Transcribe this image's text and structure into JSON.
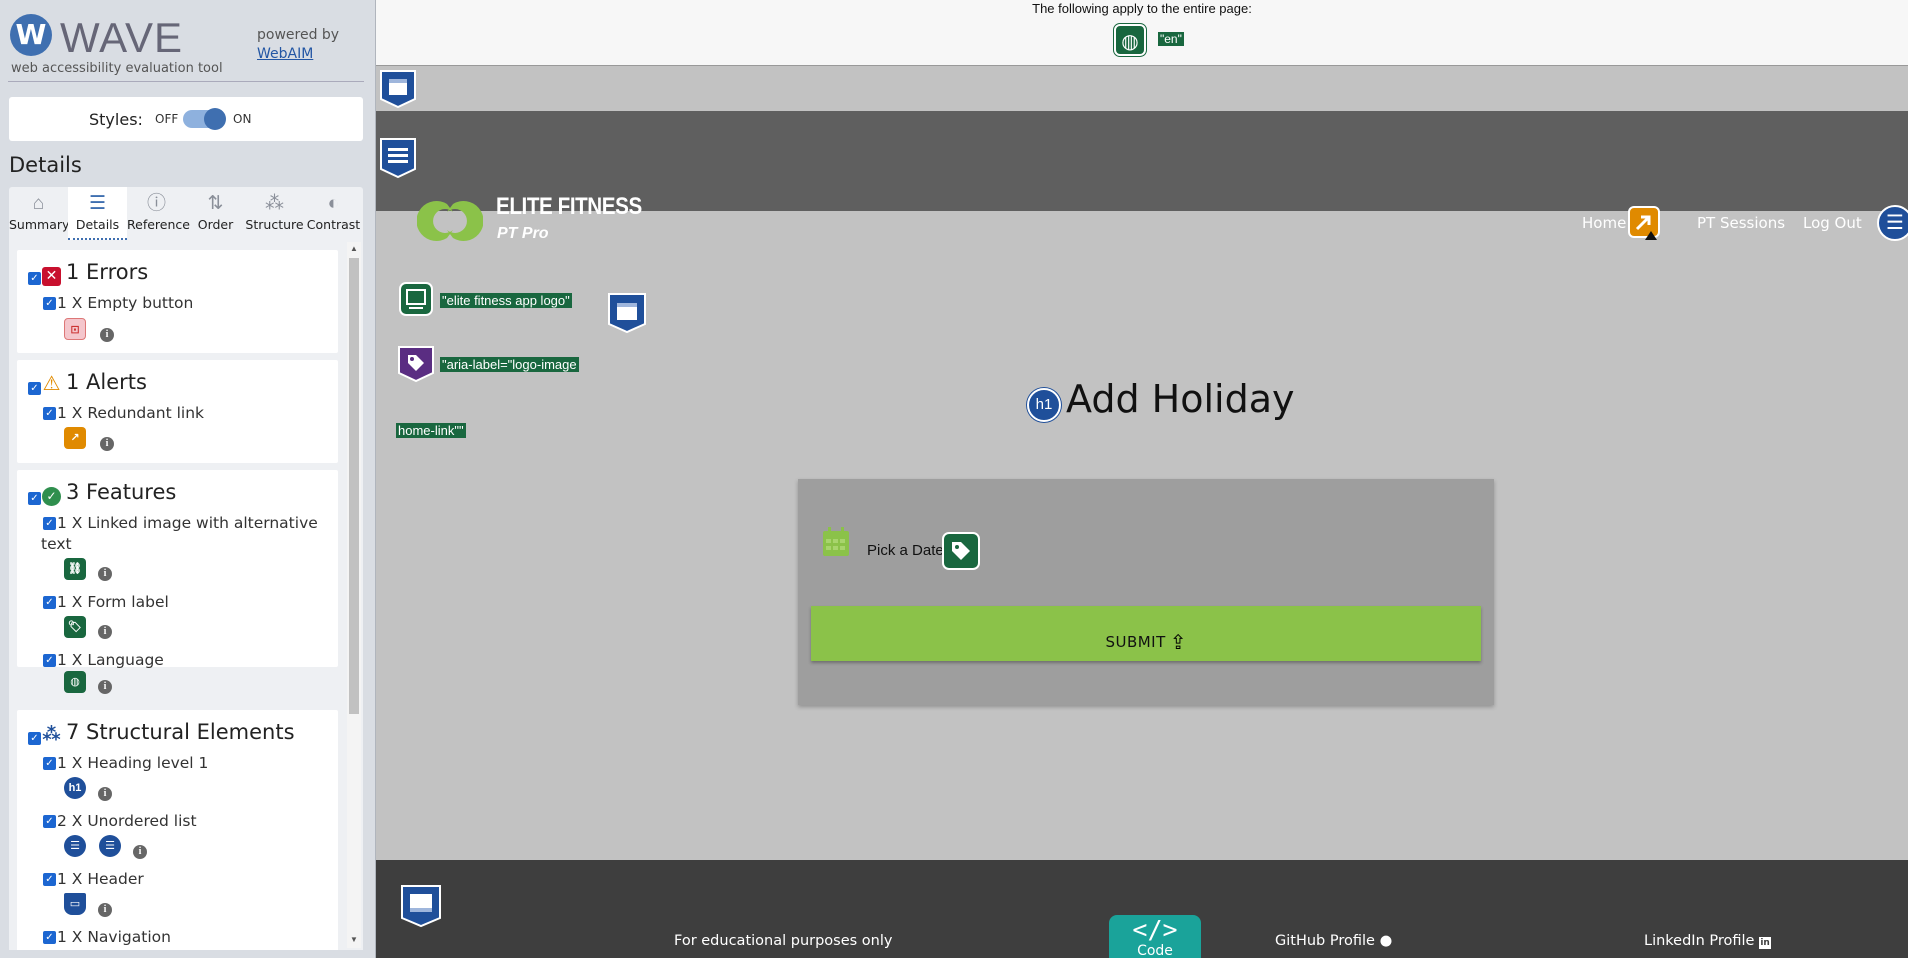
{
  "wave": {
    "logo_mark": "W",
    "logo_text": "WAVE",
    "tagline": "web accessibility evaluation tool",
    "powered_by": "powered by",
    "webaim_link": "WebAIM",
    "styles_label": "Styles:",
    "styles_off": "OFF",
    "styles_on": "ON",
    "details_title": "Details",
    "tabs": [
      {
        "label": "Summary",
        "icon": "home-icon",
        "glyph": "⌂"
      },
      {
        "label": "Details",
        "icon": "list-icon",
        "glyph": "☰",
        "active": true
      },
      {
        "label": "Reference",
        "icon": "info-icon",
        "glyph": "ⓘ"
      },
      {
        "label": "Order",
        "icon": "order-icon",
        "glyph": "⇅"
      },
      {
        "label": "Structure",
        "icon": "structure-icon",
        "glyph": "⁂"
      },
      {
        "label": "Contrast",
        "icon": "contrast-icon",
        "glyph": "◐"
      }
    ],
    "categories": {
      "errors": {
        "heading": "1 Errors",
        "color": "#c8102e",
        "items": [
          {
            "label": "1 X Empty button",
            "icon": "empty-button-icon"
          }
        ]
      },
      "alerts": {
        "heading": "1 Alerts",
        "color": "#e08a00",
        "items": [
          {
            "label": "1 X Redundant link",
            "icon": "redundant-link-icon"
          }
        ]
      },
      "features": {
        "heading": "3 Features",
        "color": "#2f8f4e",
        "items": [
          {
            "label": "1 X Linked image with alternative text",
            "icon": "linked-image-icon"
          },
          {
            "label": "1 X Form label",
            "icon": "form-label-icon"
          },
          {
            "label": "1 X Language",
            "icon": "language-icon"
          }
        ]
      },
      "structure": {
        "heading": "7 Structural Elements",
        "color": "#1f4f9a",
        "items": [
          {
            "label": "1 X Heading level 1",
            "icon": "heading-icon"
          },
          {
            "label": "2 X Unordered list",
            "icon": "unordered-list-icon"
          },
          {
            "label": "1 X Header",
            "icon": "header-icon"
          },
          {
            "label": "1 X Navigation",
            "icon": "navigation-icon"
          }
        ]
      }
    }
  },
  "page": {
    "notice": "The following apply to the entire page:",
    "lang_tag": "\"en\"",
    "brand_title": "ELITE FITNESS",
    "brand_sub": "PT Pro",
    "nav": [
      "Home",
      "PT Sessions",
      "Log Out"
    ],
    "alt_tag": "\"elite fitness app logo\"",
    "aria_tag": "\"aria-label=\"logo-image",
    "homelink_tag": "home-link\"\"",
    "title": "Add Holiday",
    "h1_badge": "h1",
    "pick_date": "Pick a Date",
    "submit": "SUBMIT",
    "footer": {
      "educational": "For educational purposes only",
      "code_glyph": "</>",
      "code_word": "Code",
      "github": "GitHub Profile",
      "linkedin": "LinkedIn Profile"
    }
  },
  "colors": {
    "error": "#c8102e",
    "alert": "#e08a00",
    "feature": "#19673f",
    "structure": "#1f4f9a",
    "accent_green": "#8bc249",
    "navbar": "#5f5f5f",
    "footer": "#3e3e3e"
  }
}
